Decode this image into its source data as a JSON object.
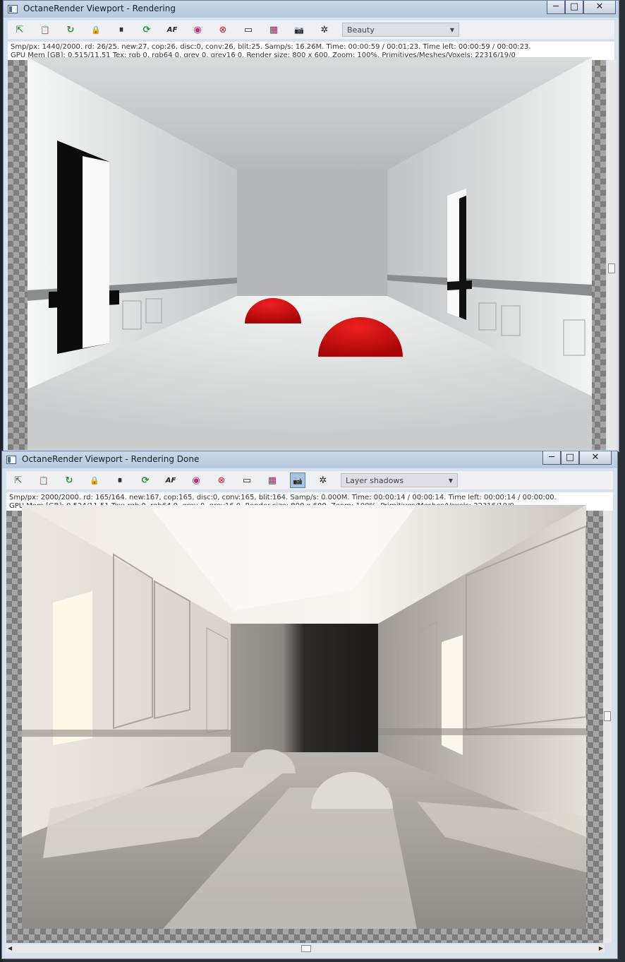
{
  "viewport1": {
    "title": "OctaneRender Viewport - Rendering",
    "controls": {
      "minimize": "─",
      "maximize": "□",
      "close": "✕"
    },
    "render_pass": "Beauty",
    "status_line1": "Smp/px: 1440/2000.   rd: 26/25.   new:27, cop:26, disc:0, conv:26, blit:25.   Samp/s: 16.26M.   Time: 00:00:59 / 00:01:23.   Time left: 00:00:59 / 00:00:23.",
    "status_line2": "GPU Mem [GB]: 0.515/11.51   Tex: rgb 0, rgb64 0, grey 0, grey16 0.   Render size: 800 x 600.   Zoom: 100%.   Primitives/Meshes/Voxels: 22316/19/0"
  },
  "viewport2": {
    "title": "OctaneRender Viewport - Rendering Done",
    "controls": {
      "minimize": "─",
      "maximize": "□",
      "close": "✕"
    },
    "render_pass": "Layer shadows",
    "status_line1": "Smp/px: 2000/2000.   rd: 165/164.   new:167, cop:165, disc:0, conv:165, blit:164.   Samp/s: 0.000M.   Time: 00:00:14 / 00:00:14.   Time left: 00:00:14 / 00:00:00.",
    "status_line2": "GPU Mem [GB]: 0.524/11.51   Tex: rgb 0, rgb64 0, grey 0, grey16 0.   Render size: 800 x 600.   Zoom: 100%.   Primitives/Meshes/Voxels: 22316/19/0"
  },
  "toolbar_icons": [
    "export-icon",
    "clipboard-icon",
    "restart-render-icon",
    "lock-icon",
    "pause-icon",
    "refresh-icon",
    "af-focus-icon",
    "color-picker-icon",
    "material-picker-icon",
    "display-icon",
    "film-icon",
    "camera-snapshot-icon",
    "settings-icon"
  ],
  "toolbar_glyphs": [
    "⇱",
    "📋",
    "↻",
    "🔒",
    "⏸",
    "⟳",
    "AF",
    "◉",
    "⊗",
    "▭",
    "▦",
    "📷",
    "✲"
  ],
  "colors": {
    "sphere_red": "#cc0a0a",
    "title_bar": "#c9d8ea",
    "active_button": "#a9c3e3"
  }
}
